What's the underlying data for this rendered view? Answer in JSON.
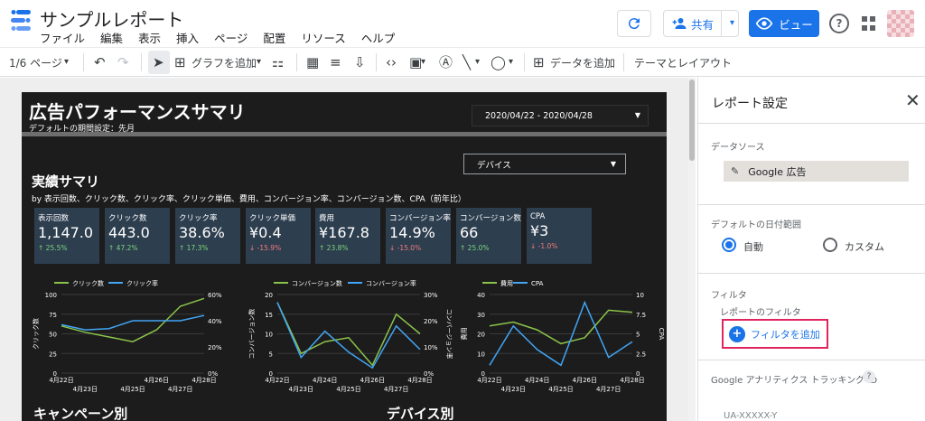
{
  "header": {
    "title": "サンプルレポート",
    "menus": [
      "ファイル",
      "編集",
      "表示",
      "挿入",
      "ページ",
      "配置",
      "リソース",
      "ヘルプ"
    ],
    "share_label": "共有",
    "view_label": "ビュー",
    "help_label": "?"
  },
  "toolbar": {
    "page_selector": "1/6 ページ",
    "add_chart": "グラフを追加",
    "add_data": "データを追加",
    "theme_layout": "テーマとレイアウト"
  },
  "report": {
    "title": "広告パフォーマンスサマリ",
    "subtitle": "デフォルトの期間設定：先月",
    "date_range": "2020/04/22 - 2020/04/28",
    "device_selector": "デバイス",
    "section_summary": "実績サマリ",
    "section_summary_sub": "by 表示回数、クリック数、クリック率、クリック単価、費用、コンバージョン率、コンバージョン数、CPA（前年比）",
    "section_campaign": "キャンペーン別",
    "section_device": "デバイス別",
    "kpis": [
      {
        "label": "表示回数",
        "value": "1,147.0",
        "delta": "↑ 25.5%",
        "dir": "up"
      },
      {
        "label": "クリック数",
        "value": "443.0",
        "delta": "↑ 47.2%",
        "dir": "up"
      },
      {
        "label": "クリック率",
        "value": "38.6%",
        "delta": "↑ 17.3%",
        "dir": "up"
      },
      {
        "label": "クリック単価",
        "value": "¥0.4",
        "delta": "↓ -15.9%",
        "dir": "down"
      },
      {
        "label": "費用",
        "value": "¥167.8",
        "delta": "↑ 23.8%",
        "dir": "up"
      },
      {
        "label": "コンバージョン率",
        "value": "14.9%",
        "delta": "↓ -15.0%",
        "dir": "down"
      },
      {
        "label": "コンバージョン数",
        "value": "66",
        "delta": "↑ 25.0%",
        "dir": "up"
      },
      {
        "label": "CPA",
        "value": "¥3",
        "delta": "↓ -1.0%",
        "dir": "down"
      }
    ]
  },
  "colors": {
    "series_green": "#8bc34a",
    "series_blue": "#42a5f5",
    "kpi_bg": "#2d3e4f",
    "accent": "#1a73e8",
    "highlight": "#e0245e"
  },
  "chart_data": [
    {
      "type": "line",
      "x": [
        "4月22日",
        "4月23日",
        "4月24日",
        "4月25日",
        "4月26日",
        "4月27日",
        "4月28日"
      ],
      "x_tick_labels": [
        "4月22日",
        "4月23日",
        "4月25日",
        "4月26日",
        "4月27日",
        "4月28日"
      ],
      "series": [
        {
          "name": "クリック数",
          "axis": "left",
          "values": [
            60,
            52,
            46,
            40,
            55,
            85,
            95
          ]
        },
        {
          "name": "クリック率",
          "axis": "right",
          "values": [
            37,
            33,
            34,
            40,
            40,
            40,
            44
          ]
        }
      ],
      "ylabel_left": "クリック数",
      "ylim_left": [
        0,
        100
      ],
      "yticks_left": [
        "0",
        "25",
        "50",
        "75",
        "100"
      ],
      "ylim_right": [
        0,
        60
      ],
      "yticks_right": [
        "0%",
        "20%",
        "40%",
        "60%"
      ]
    },
    {
      "type": "line",
      "x": [
        "4月22日",
        "4月23日",
        "4月24日",
        "4月25日",
        "4月26日",
        "4月27日",
        "4月28日"
      ],
      "x_tick_labels": [
        "4月22日",
        "4月23日",
        "4月24日",
        "4月25日",
        "4月26日",
        "4月27日",
        "4月28日"
      ],
      "series": [
        {
          "name": "コンバージョン数",
          "axis": "left",
          "values": [
            18,
            5,
            8,
            9,
            2,
            15,
            10
          ]
        },
        {
          "name": "コンバージョン率",
          "axis": "right",
          "values": [
            27,
            6,
            16,
            8,
            2,
            18,
            9
          ]
        }
      ],
      "ylabel_left": "コンバージョン数",
      "ylabel_right": "コンバージョン率",
      "ylim_left": [
        0,
        20
      ],
      "yticks_left": [
        "0",
        "5",
        "10",
        "15",
        "20"
      ],
      "ylim_right": [
        0,
        30
      ],
      "yticks_right": [
        "0%",
        "10%",
        "20%",
        "30%"
      ]
    },
    {
      "type": "line",
      "x": [
        "4月22日",
        "4月23日",
        "4月24日",
        "4月25日",
        "4月26日",
        "4月27日",
        "4月28日"
      ],
      "x_tick_labels": [
        "4月22日",
        "4月23日",
        "4月24日",
        "4月25日",
        "4月26日",
        "4月27日",
        "4月28日"
      ],
      "series": [
        {
          "name": "費用",
          "axis": "left",
          "values": [
            24,
            26,
            22,
            15,
            18,
            32,
            31
          ]
        },
        {
          "name": "CPA",
          "axis": "right",
          "values": [
            1,
            6,
            3,
            1,
            9,
            2,
            4
          ]
        }
      ],
      "ylabel_left": "費用",
      "ylabel_right": "CPA",
      "ylim_left": [
        0,
        40
      ],
      "yticks_left": [
        "0",
        "10",
        "20",
        "30",
        "40"
      ],
      "ylim_right": [
        0,
        10
      ],
      "yticks_right": [
        "0",
        "2.5",
        "5",
        "7.5",
        "10"
      ]
    }
  ],
  "panel": {
    "title": "レポート設定",
    "datasource_label": "データソース",
    "datasource_name": "Google 広告",
    "daterange_label": "デフォルトの日付範囲",
    "radio_auto": "自動",
    "radio_custom": "カスタム",
    "filter_label": "フィルタ",
    "report_filter_label": "レポートのフィルタ",
    "add_filter": "フィルタを追加",
    "ga_label": "Google アナリティクス トラッキング ID",
    "ga_placeholder": "UA-XXXXX-Y"
  }
}
